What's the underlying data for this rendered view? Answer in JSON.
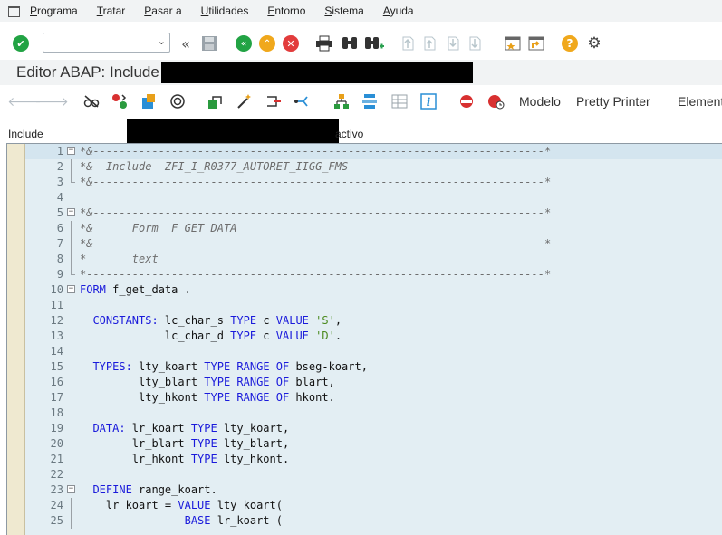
{
  "menu": [
    "Programa",
    "Tratar",
    "Pasar a",
    "Utilidades",
    "Entorno",
    "Sistema",
    "Ayuda"
  ],
  "menu_underline": [
    "P",
    "T",
    "P",
    "U",
    "E",
    "S",
    "A"
  ],
  "command_field": {
    "value": ""
  },
  "title": "Editor ABAP: Include",
  "app_toolbar": {
    "modelo": "Modelo",
    "pretty_printer": "Pretty Printer",
    "elementos": "Element"
  },
  "status": {
    "include_label": "Include",
    "state_suffix": "activo"
  },
  "editor": {
    "lines": [
      {
        "n": "1",
        "fold": "box",
        "code": [
          {
            "t": "*&---------------------------------------------------------------------*",
            "c": "cmt"
          }
        ]
      },
      {
        "n": "2",
        "fold": "guide",
        "code": [
          {
            "t": "*&  Include  ZFI_I_R0377_AUTORET_IIGG_FMS",
            "c": "cmt"
          }
        ]
      },
      {
        "n": "3",
        "fold": "end",
        "code": [
          {
            "t": "*&---------------------------------------------------------------------*",
            "c": "cmt"
          }
        ]
      },
      {
        "n": "4",
        "fold": "",
        "code": []
      },
      {
        "n": "5",
        "fold": "box",
        "code": [
          {
            "t": "*&---------------------------------------------------------------------*",
            "c": "cmt"
          }
        ]
      },
      {
        "n": "6",
        "fold": "guide",
        "code": [
          {
            "t": "*&      Form  F_GET_DATA",
            "c": "cmt"
          }
        ]
      },
      {
        "n": "7",
        "fold": "guide",
        "code": [
          {
            "t": "*&---------------------------------------------------------------------*",
            "c": "cmt"
          }
        ]
      },
      {
        "n": "8",
        "fold": "guide",
        "code": [
          {
            "t": "*       text",
            "c": "cmt"
          }
        ]
      },
      {
        "n": "9",
        "fold": "end",
        "code": [
          {
            "t": "*----------------------------------------------------------------------*",
            "c": "cmt"
          }
        ]
      },
      {
        "n": "10",
        "fold": "box",
        "code": [
          {
            "t": "FORM",
            "c": "kw"
          },
          {
            "t": " f_get_data .",
            "c": ""
          }
        ]
      },
      {
        "n": "11",
        "fold": "",
        "code": []
      },
      {
        "n": "12",
        "fold": "",
        "code": [
          {
            "t": "  ",
            "c": ""
          },
          {
            "t": "CONSTANTS:",
            "c": "kw"
          },
          {
            "t": " lc_char_s ",
            "c": ""
          },
          {
            "t": "TYPE",
            "c": "kw"
          },
          {
            "t": " c ",
            "c": ""
          },
          {
            "t": "VALUE",
            "c": "kw"
          },
          {
            "t": " ",
            "c": ""
          },
          {
            "t": "'S'",
            "c": "str"
          },
          {
            "t": ",",
            "c": ""
          }
        ]
      },
      {
        "n": "13",
        "fold": "",
        "code": [
          {
            "t": "             lc_char_d ",
            "c": ""
          },
          {
            "t": "TYPE",
            "c": "kw"
          },
          {
            "t": " c ",
            "c": ""
          },
          {
            "t": "VALUE",
            "c": "kw"
          },
          {
            "t": " ",
            "c": ""
          },
          {
            "t": "'D'",
            "c": "str"
          },
          {
            "t": ".",
            "c": ""
          }
        ]
      },
      {
        "n": "14",
        "fold": "",
        "code": []
      },
      {
        "n": "15",
        "fold": "",
        "code": [
          {
            "t": "  ",
            "c": ""
          },
          {
            "t": "TYPES:",
            "c": "kw"
          },
          {
            "t": " lty_koart ",
            "c": ""
          },
          {
            "t": "TYPE RANGE OF",
            "c": "kw"
          },
          {
            "t": " bseg-koart,",
            "c": ""
          }
        ]
      },
      {
        "n": "16",
        "fold": "",
        "code": [
          {
            "t": "         lty_blart ",
            "c": ""
          },
          {
            "t": "TYPE RANGE OF",
            "c": "kw"
          },
          {
            "t": " blart,",
            "c": ""
          }
        ]
      },
      {
        "n": "17",
        "fold": "",
        "code": [
          {
            "t": "         lty_hkont ",
            "c": ""
          },
          {
            "t": "TYPE RANGE OF",
            "c": "kw"
          },
          {
            "t": " hkont.",
            "c": ""
          }
        ]
      },
      {
        "n": "18",
        "fold": "",
        "code": []
      },
      {
        "n": "19",
        "fold": "",
        "code": [
          {
            "t": "  ",
            "c": ""
          },
          {
            "t": "DATA:",
            "c": "kw"
          },
          {
            "t": " lr_koart ",
            "c": ""
          },
          {
            "t": "TYPE",
            "c": "kw"
          },
          {
            "t": " lty_koart,",
            "c": ""
          }
        ]
      },
      {
        "n": "20",
        "fold": "",
        "code": [
          {
            "t": "        lr_blart ",
            "c": ""
          },
          {
            "t": "TYPE",
            "c": "kw"
          },
          {
            "t": " lty_blart,",
            "c": ""
          }
        ]
      },
      {
        "n": "21",
        "fold": "",
        "code": [
          {
            "t": "        lr_hkont ",
            "c": ""
          },
          {
            "t": "TYPE",
            "c": "kw"
          },
          {
            "t": " lty_hkont.",
            "c": ""
          }
        ]
      },
      {
        "n": "22",
        "fold": "",
        "code": []
      },
      {
        "n": "23",
        "fold": "box",
        "code": [
          {
            "t": "  ",
            "c": ""
          },
          {
            "t": "DEFINE",
            "c": "kw"
          },
          {
            "t": " range_koart.",
            "c": ""
          }
        ]
      },
      {
        "n": "24",
        "fold": "guide",
        "code": [
          {
            "t": "    lr_koart = ",
            "c": ""
          },
          {
            "t": "VALUE",
            "c": "kw"
          },
          {
            "t": " lty_koart(",
            "c": ""
          }
        ]
      },
      {
        "n": "25",
        "fold": "guide",
        "code": [
          {
            "t": "                ",
            "c": ""
          },
          {
            "t": "BASE",
            "c": "kw"
          },
          {
            "t": " lr_koart (",
            "c": ""
          }
        ]
      }
    ]
  }
}
